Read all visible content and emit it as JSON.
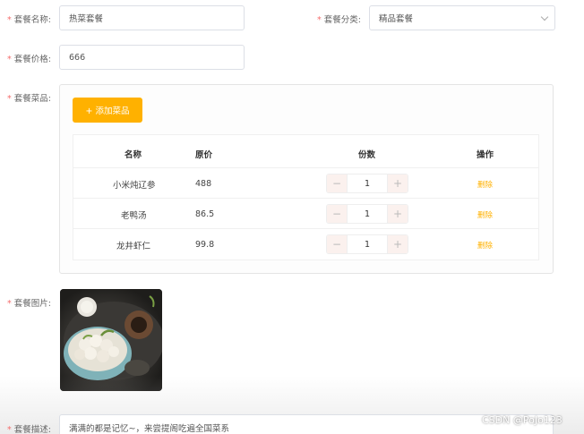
{
  "form": {
    "name": {
      "label": "套餐名称:",
      "value": "热菜套餐"
    },
    "category": {
      "label": "套餐分类:",
      "value": "精品套餐"
    },
    "price": {
      "label": "套餐价格:",
      "value": "666"
    },
    "dishes": {
      "label": "套餐菜品:"
    },
    "image": {
      "label": "套餐图片:"
    },
    "description": {
      "label": "套餐描述:",
      "value": "满满的都是记忆~，来尝提阁吃遍全国菜系"
    }
  },
  "dish_panel": {
    "add_label": "+ 添加菜品",
    "columns": {
      "name": "名称",
      "price": "原价",
      "qty": "份数",
      "action": "操作"
    },
    "rows": [
      {
        "name": "小米炖辽参",
        "price": "488",
        "qty": "1",
        "action": "删除"
      },
      {
        "name": "老鸭汤",
        "price": "86.5",
        "qty": "1",
        "action": "删除"
      },
      {
        "name": "龙井虾仁",
        "price": "99.8",
        "qty": "1",
        "action": "删除"
      }
    ],
    "minus": "−",
    "plus": "+"
  },
  "watermark": "CSDN @PoJo123",
  "colors": {
    "accent": "#ffb100",
    "required": "#f56c6c"
  }
}
